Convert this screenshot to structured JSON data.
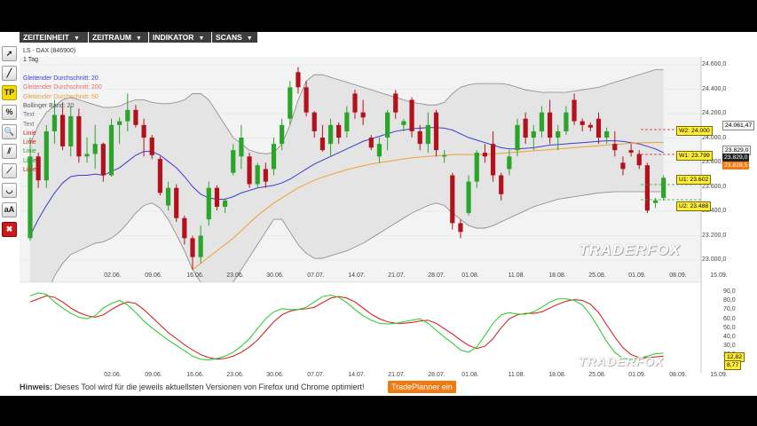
{
  "menu": [
    {
      "label": "ZEITEINHEIT",
      "x": 22,
      "w": 78
    },
    {
      "label": "ZEITRAUM",
      "x": 100,
      "w": 68
    },
    {
      "label": "INDIKATOR",
      "x": 168,
      "w": 71
    },
    {
      "label": "SCANS",
      "x": 239,
      "w": 52
    }
  ],
  "toolbar": [
    {
      "name": "select-tool",
      "glyph": "➚"
    },
    {
      "name": "line-tool",
      "glyph": "╱"
    },
    {
      "name": "tradeplanner-tool",
      "glyph": "TP"
    },
    {
      "name": "percent-tool",
      "glyph": "%"
    },
    {
      "name": "zoom-tool",
      "glyph": "🔍"
    },
    {
      "name": "channel-tool",
      "glyph": "⫽"
    },
    {
      "name": "trend-tool",
      "glyph": "⟋"
    },
    {
      "name": "curve-tool",
      "glyph": "◡"
    },
    {
      "name": "text-tool",
      "glyph": "aA"
    },
    {
      "name": "delete-tool",
      "glyph": "✖"
    }
  ],
  "instrument": {
    "name": "LS - DAX (846900)",
    "timeframe": "1 Tag"
  },
  "legend": [
    {
      "label": "Gleitender Durchschnitt: 20",
      "color": "#3b3bd0"
    },
    {
      "label": "Gleitender Durchschnitt: 200",
      "color": "#e07070"
    },
    {
      "label": "Gleitender Durchschnitt: 50",
      "color": "#e0a040"
    },
    {
      "label": "Bollinger Band: 20",
      "color": "#555555"
    },
    {
      "label": "Text",
      "color": "#777777"
    },
    {
      "label": "Text",
      "color": "#777777"
    },
    {
      "label": "Linie",
      "color": "#cc2020"
    },
    {
      "label": "Linie",
      "color": "#cc2020"
    },
    {
      "label": "Linie",
      "color": "#20a020"
    },
    {
      "label": "Linie",
      "color": "#20a020"
    },
    {
      "label": "Linie",
      "color": "#cc2020"
    }
  ],
  "price_axis": [
    "24.600,0",
    "24.400,0",
    "24.200,0",
    "24.000,0",
    "23.800,0",
    "23.600,0",
    "23.400,0",
    "23.200,0",
    "23.000,0"
  ],
  "osc_axis": [
    "90,0",
    "80,0",
    "70,0",
    "60,0",
    "50,0",
    "40,0",
    "30,0",
    "20,0",
    "10,0"
  ],
  "dates": [
    "02.06.",
    "09.06.",
    "16.06.",
    "23.06.",
    "30.06.",
    "07.07.",
    "14.07.",
    "21.07.",
    "28.07.",
    "01.08.",
    "11.08.",
    "18.08.",
    "25.08.",
    "01.09.",
    "08.09.",
    "15.09."
  ],
  "price_tags": {
    "w2": "W2: 24.000",
    "w1": "W1: 23.799",
    "u1": "U1: 23.602",
    "u2": "U2: 23.488",
    "p1": "24.061,47",
    "p2": "23.829,0",
    "p3": "23.828,5",
    "p4": "23.829,0"
  },
  "osc_tags": {
    "k": "12,82",
    "d": "8,77"
  },
  "watermark": "TRADERFOX",
  "hint": {
    "bold": "Hinweis:",
    "text": " Dieses Tool wird für die jeweils aktuellsten Versionen von Firefox und Chrome optimiert!"
  },
  "planner_button": "TradePlanner ein",
  "colors": {
    "up": "#2aa52a",
    "down": "#b3121c",
    "ma20": "#3b3bd0",
    "ma50": "#f0a030",
    "band": "#888888",
    "k": "#22cc22",
    "d": "#dd1111"
  },
  "chart_data": {
    "type": "candlestick",
    "title": "LS - DAX (846900)",
    "y_range": [
      22950,
      24700
    ],
    "candles": [
      {
        "o": 23300,
        "h": 24100,
        "l": 23280,
        "c": 23950
      },
      {
        "o": 23950,
        "h": 23980,
        "l": 23700,
        "c": 23760
      },
      {
        "o": 23760,
        "h": 24200,
        "l": 23700,
        "c": 24150
      },
      {
        "o": 24150,
        "h": 24400,
        "l": 24050,
        "c": 24280
      },
      {
        "o": 24280,
        "h": 24380,
        "l": 24000,
        "c": 24030
      },
      {
        "o": 24030,
        "h": 24350,
        "l": 23950,
        "c": 24270
      },
      {
        "o": 24270,
        "h": 24330,
        "l": 23900,
        "c": 23950
      },
      {
        "o": 23950,
        "h": 24100,
        "l": 23900,
        "c": 23970
      },
      {
        "o": 23970,
        "h": 24200,
        "l": 23850,
        "c": 24050
      },
      {
        "o": 24050,
        "h": 24060,
        "l": 23750,
        "c": 23800
      },
      {
        "o": 23800,
        "h": 24250,
        "l": 23790,
        "c": 24200
      },
      {
        "o": 24200,
        "h": 24260,
        "l": 24050,
        "c": 24230
      },
      {
        "o": 24230,
        "h": 24450,
        "l": 24150,
        "c": 24320
      },
      {
        "o": 24320,
        "h": 24360,
        "l": 24180,
        "c": 24200
      },
      {
        "o": 24200,
        "h": 24250,
        "l": 23950,
        "c": 24100
      },
      {
        "o": 24100,
        "h": 24120,
        "l": 23930,
        "c": 23960
      },
      {
        "o": 23930,
        "h": 23950,
        "l": 23640,
        "c": 23660
      },
      {
        "o": 23560,
        "h": 23750,
        "l": 23520,
        "c": 23700
      },
      {
        "o": 23700,
        "h": 23730,
        "l": 23430,
        "c": 23460
      },
      {
        "o": 23460,
        "h": 23480,
        "l": 23250,
        "c": 23300
      },
      {
        "o": 23300,
        "h": 23320,
        "l": 23050,
        "c": 23150
      },
      {
        "o": 23150,
        "h": 23400,
        "l": 23100,
        "c": 23320
      },
      {
        "o": 23450,
        "h": 23750,
        "l": 23400,
        "c": 23700
      },
      {
        "o": 23700,
        "h": 23720,
        "l": 23520,
        "c": 23550
      },
      {
        "o": 23550,
        "h": 23620,
        "l": 23500,
        "c": 23600
      },
      {
        "o": 23820,
        "h": 24050,
        "l": 23800,
        "c": 24000
      },
      {
        "o": 23950,
        "h": 24200,
        "l": 23850,
        "c": 24100
      },
      {
        "o": 23950,
        "h": 23980,
        "l": 23700,
        "c": 23730
      },
      {
        "o": 23730,
        "h": 23900,
        "l": 23700,
        "c": 23880
      },
      {
        "o": 23850,
        "h": 23900,
        "l": 23700,
        "c": 23750
      },
      {
        "o": 23850,
        "h": 24100,
        "l": 23800,
        "c": 24050
      },
      {
        "o": 24050,
        "h": 24250,
        "l": 24000,
        "c": 24200
      },
      {
        "o": 24250,
        "h": 24550,
        "l": 24200,
        "c": 24500
      },
      {
        "o": 24620,
        "h": 24660,
        "l": 24450,
        "c": 24500
      },
      {
        "o": 24500,
        "h": 24550,
        "l": 24270,
        "c": 24300
      },
      {
        "o": 24300,
        "h": 24310,
        "l": 24100,
        "c": 24150
      },
      {
        "o": 24100,
        "h": 24200,
        "l": 23990,
        "c": 24000
      },
      {
        "o": 24050,
        "h": 24250,
        "l": 23950,
        "c": 24200
      },
      {
        "o": 24200,
        "h": 24220,
        "l": 24050,
        "c": 24100
      },
      {
        "o": 24150,
        "h": 24350,
        "l": 24100,
        "c": 24300
      },
      {
        "o": 24450,
        "h": 24480,
        "l": 24250,
        "c": 24300
      },
      {
        "o": 24300,
        "h": 24400,
        "l": 24200,
        "c": 24260
      },
      {
        "o": 24100,
        "h": 24120,
        "l": 24000,
        "c": 24020
      },
      {
        "o": 23950,
        "h": 24100,
        "l": 23900,
        "c": 24050
      },
      {
        "o": 24100,
        "h": 24320,
        "l": 24000,
        "c": 24300
      },
      {
        "o": 24450,
        "h": 24480,
        "l": 24250,
        "c": 24300
      },
      {
        "o": 24200,
        "h": 24250,
        "l": 24150,
        "c": 24230
      },
      {
        "o": 24400,
        "h": 24420,
        "l": 24100,
        "c": 24150
      },
      {
        "o": 24150,
        "h": 24200,
        "l": 24000,
        "c": 24050
      },
      {
        "o": 24050,
        "h": 24300,
        "l": 23980,
        "c": 24200
      },
      {
        "o": 24300,
        "h": 24320,
        "l": 23950,
        "c": 24000
      },
      {
        "o": 23950,
        "h": 24000,
        "l": 23900,
        "c": 23960
      },
      {
        "o": 23800,
        "h": 23820,
        "l": 23370,
        "c": 23420
      },
      {
        "o": 23420,
        "h": 23450,
        "l": 23300,
        "c": 23350
      },
      {
        "o": 23500,
        "h": 23800,
        "l": 23480,
        "c": 23750
      },
      {
        "o": 23750,
        "h": 24000,
        "l": 23700,
        "c": 23980
      },
      {
        "o": 23980,
        "h": 24050,
        "l": 23900,
        "c": 23950
      },
      {
        "o": 24050,
        "h": 24150,
        "l": 23750,
        "c": 23800
      },
      {
        "o": 23800,
        "h": 23820,
        "l": 23600,
        "c": 23650
      },
      {
        "o": 23850,
        "h": 24000,
        "l": 23800,
        "c": 23950
      },
      {
        "o": 24000,
        "h": 24250,
        "l": 23950,
        "c": 24200
      },
      {
        "o": 24250,
        "h": 24300,
        "l": 24050,
        "c": 24100
      },
      {
        "o": 24100,
        "h": 24200,
        "l": 24000,
        "c": 24150
      },
      {
        "o": 24150,
        "h": 24350,
        "l": 24100,
        "c": 24300
      },
      {
        "o": 24300,
        "h": 24400,
        "l": 24050,
        "c": 24100
      },
      {
        "o": 24100,
        "h": 24200,
        "l": 24000,
        "c": 24150
      },
      {
        "o": 24150,
        "h": 24350,
        "l": 24120,
        "c": 24300
      },
      {
        "o": 24400,
        "h": 24450,
        "l": 24200,
        "c": 24230
      },
      {
        "o": 24230,
        "h": 24250,
        "l": 24150,
        "c": 24200
      },
      {
        "o": 24200,
        "h": 24220,
        "l": 24150,
        "c": 24180
      },
      {
        "o": 24250,
        "h": 24300,
        "l": 24050,
        "c": 24100
      },
      {
        "o": 24100,
        "h": 24180,
        "l": 24050,
        "c": 24150
      },
      {
        "o": 24050,
        "h": 24150,
        "l": 23950,
        "c": 24000
      },
      {
        "o": 23900,
        "h": 23950,
        "l": 23800,
        "c": 23850
      },
      {
        "o": 24000,
        "h": 24050,
        "l": 23950,
        "c": 23980
      },
      {
        "o": 23970,
        "h": 24000,
        "l": 23850,
        "c": 23880
      },
      {
        "o": 23880,
        "h": 23900,
        "l": 23500,
        "c": 23520
      },
      {
        "o": 23580,
        "h": 23620,
        "l": 23540,
        "c": 23600
      },
      {
        "o": 23620,
        "h": 23800,
        "l": 23600,
        "c": 23780
      }
    ],
    "ma20": [
      23320,
      23450,
      23560,
      23660,
      23740,
      23790,
      23800,
      23800,
      23810,
      23800,
      23830,
      23860,
      23910,
      23960,
      23990,
      23990,
      23960,
      23910,
      23860,
      23790,
      23710,
      23650,
      23620,
      23610,
      23610,
      23630,
      23660,
      23680,
      23700,
      23710,
      23720,
      23740,
      23770,
      23810,
      23850,
      23890,
      23920,
      23950,
      23980,
      24010,
      24040,
      24070,
      24090,
      24110,
      24130,
      24150,
      24160,
      24170,
      24175,
      24180,
      24180,
      24175,
      24160,
      24130,
      24100,
      24080,
      24060,
      24040,
      24020,
      24010,
      24010,
      24015,
      24020,
      24030,
      24040,
      24045,
      24050,
      24055,
      24060,
      24065,
      24070,
      24075,
      24075,
      24070,
      24060,
      24050,
      24030,
      24010,
      23980
    ],
    "ma50_start": 20,
    "ma50": [
      23050,
      23100,
      23150,
      23200,
      23250,
      23300,
      23360,
      23420,
      23480,
      23530,
      23580,
      23620,
      23660,
      23700,
      23730,
      23760,
      23785,
      23805,
      23825,
      23845,
      23860,
      23875,
      23890,
      23900,
      23910,
      23920,
      23930,
      23940,
      23945,
      23950,
      23955,
      23960,
      23965,
      23965,
      23965,
      23965,
      23965,
      23970,
      23975,
      23980,
      23985,
      23990,
      23995,
      24000,
      24005,
      24010,
      24015,
      24020,
      24025,
      24030,
      24035,
      24040,
      24045,
      24050,
      24055,
      24058,
      24060,
      24061,
      24061
    ],
    "bb_upper": [
      24050,
      24200,
      24300,
      24350,
      24400,
      24420,
      24400,
      24380,
      24360,
      24340,
      24340,
      24350,
      24380,
      24400,
      24400,
      24380,
      24370,
      24370,
      24380,
      24400,
      24450,
      24450,
      24400,
      24300,
      24200,
      24100,
      24050,
      24000,
      23980,
      23970,
      23980,
      24050,
      24200,
      24400,
      24550,
      24600,
      24600,
      24580,
      24560,
      24540,
      24520,
      24500,
      24480,
      24460,
      24440,
      24420,
      24400,
      24380,
      24370,
      24360,
      24360,
      24380,
      24450,
      24500,
      24520,
      24530,
      24530,
      24530,
      24530,
      24520,
      24500,
      24480,
      24470,
      24460,
      24460,
      24460,
      24460,
      24470,
      24480,
      24490,
      24500,
      24520,
      24540,
      24560,
      24580,
      24600,
      24620,
      24640,
      24640
    ],
    "bb_lower": [
      22600,
      22750,
      22850,
      23000,
      23100,
      23170,
      23200,
      23230,
      23260,
      23270,
      23300,
      23350,
      23420,
      23500,
      23560,
      23580,
      23540,
      23450,
      23330,
      23200,
      23050,
      22950,
      22900,
      22880,
      22900,
      22950,
      23050,
      23150,
      23250,
      23350,
      23450,
      23450,
      23350,
      23250,
      23180,
      23140,
      23140,
      23160,
      23180,
      23200,
      23230,
      23260,
      23300,
      23340,
      23380,
      23420,
      23460,
      23500,
      23530,
      23560,
      23580,
      23560,
      23500,
      23450,
      23400,
      23380,
      23380,
      23400,
      23430,
      23460,
      23490,
      23520,
      23550,
      23570,
      23590,
      23610,
      23620,
      23630,
      23640,
      23650,
      23660,
      23665,
      23670,
      23670,
      23670,
      23670,
      23670,
      23670,
      23670
    ],
    "osc_k": [
      88,
      92,
      90,
      80,
      72,
      65,
      60,
      58,
      62,
      72,
      78,
      82,
      76,
      66,
      55,
      46,
      38,
      30,
      23,
      16,
      9,
      5,
      4,
      6,
      9,
      14,
      22,
      32,
      45,
      58,
      67,
      71,
      70,
      70,
      73,
      80,
      87,
      89,
      86,
      79,
      70,
      62,
      56,
      52,
      51,
      52,
      54,
      56,
      58,
      52,
      43,
      34,
      26,
      17,
      14,
      21,
      36,
      52,
      63,
      66,
      64,
      64,
      67,
      73,
      80,
      84,
      84,
      82,
      76,
      63,
      46,
      28,
      14,
      6,
      5,
      6,
      9,
      12,
      13
    ],
    "osc_d": [
      80,
      84,
      88,
      86,
      80,
      72,
      66,
      62,
      60,
      63,
      70,
      76,
      80,
      78,
      70,
      60,
      50,
      40,
      32,
      24,
      17,
      11,
      7,
      5,
      6,
      9,
      14,
      21,
      30,
      42,
      54,
      63,
      68,
      70,
      71,
      73,
      79,
      85,
      87,
      85,
      80,
      72,
      64,
      58,
      54,
      52,
      52,
      53,
      55,
      56,
      52,
      45,
      38,
      30,
      23,
      19,
      22,
      32,
      46,
      58,
      63,
      65,
      65,
      67,
      72,
      77,
      81,
      83,
      82,
      77,
      66,
      50,
      34,
      20,
      11,
      7,
      7,
      8,
      9
    ],
    "osc_range": [
      0,
      100
    ]
  }
}
